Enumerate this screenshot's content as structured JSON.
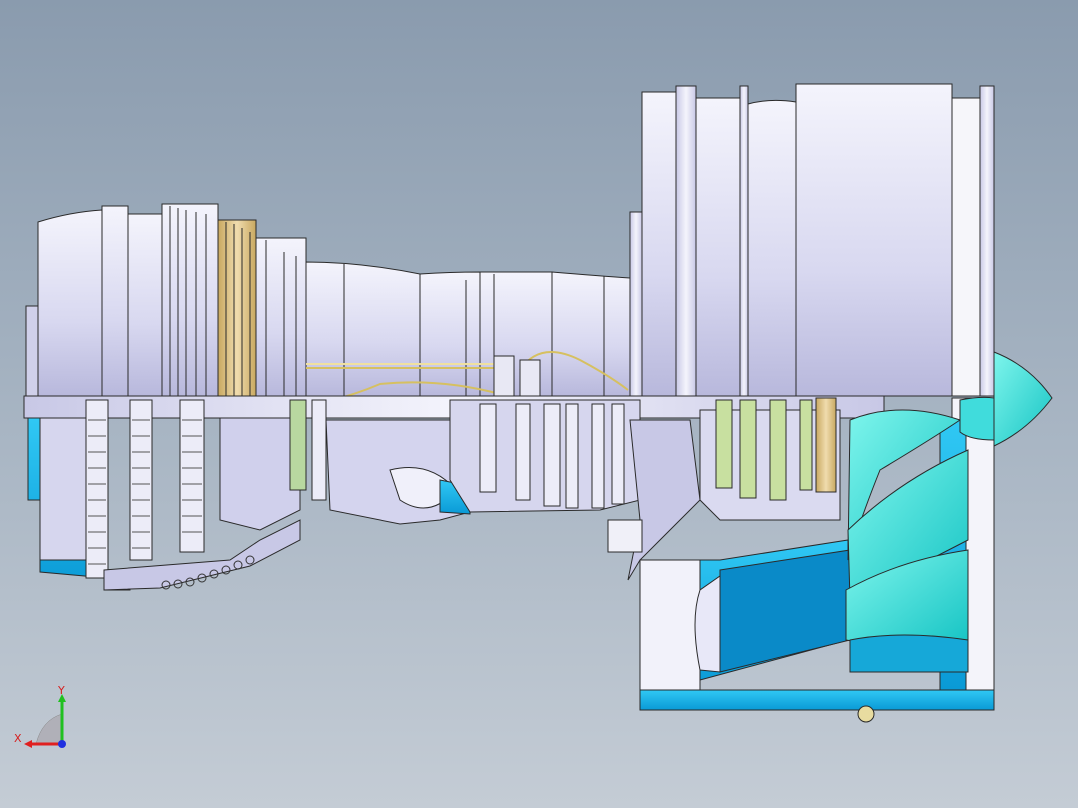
{
  "viewport": {
    "background_top": "#8a9bae",
    "background_bottom": "#c4ccd5"
  },
  "model": {
    "shell_color": "#dcdcf0",
    "shell_edge": "#2a2a2a",
    "section_color": "#1ec8f0",
    "fan_color": "#2ee6d8",
    "gold_color": "#d8c08a",
    "green_color": "#b8d8a0"
  },
  "triad": {
    "x_label": "X",
    "y_label": "Y",
    "x_icon": "x-axis-arrow-icon",
    "y_icon": "y-axis-arrow-icon",
    "z_icon": "z-axis-dot-icon",
    "x_color": "#e02020",
    "y_color": "#20c020",
    "z_color": "#2030e0"
  }
}
